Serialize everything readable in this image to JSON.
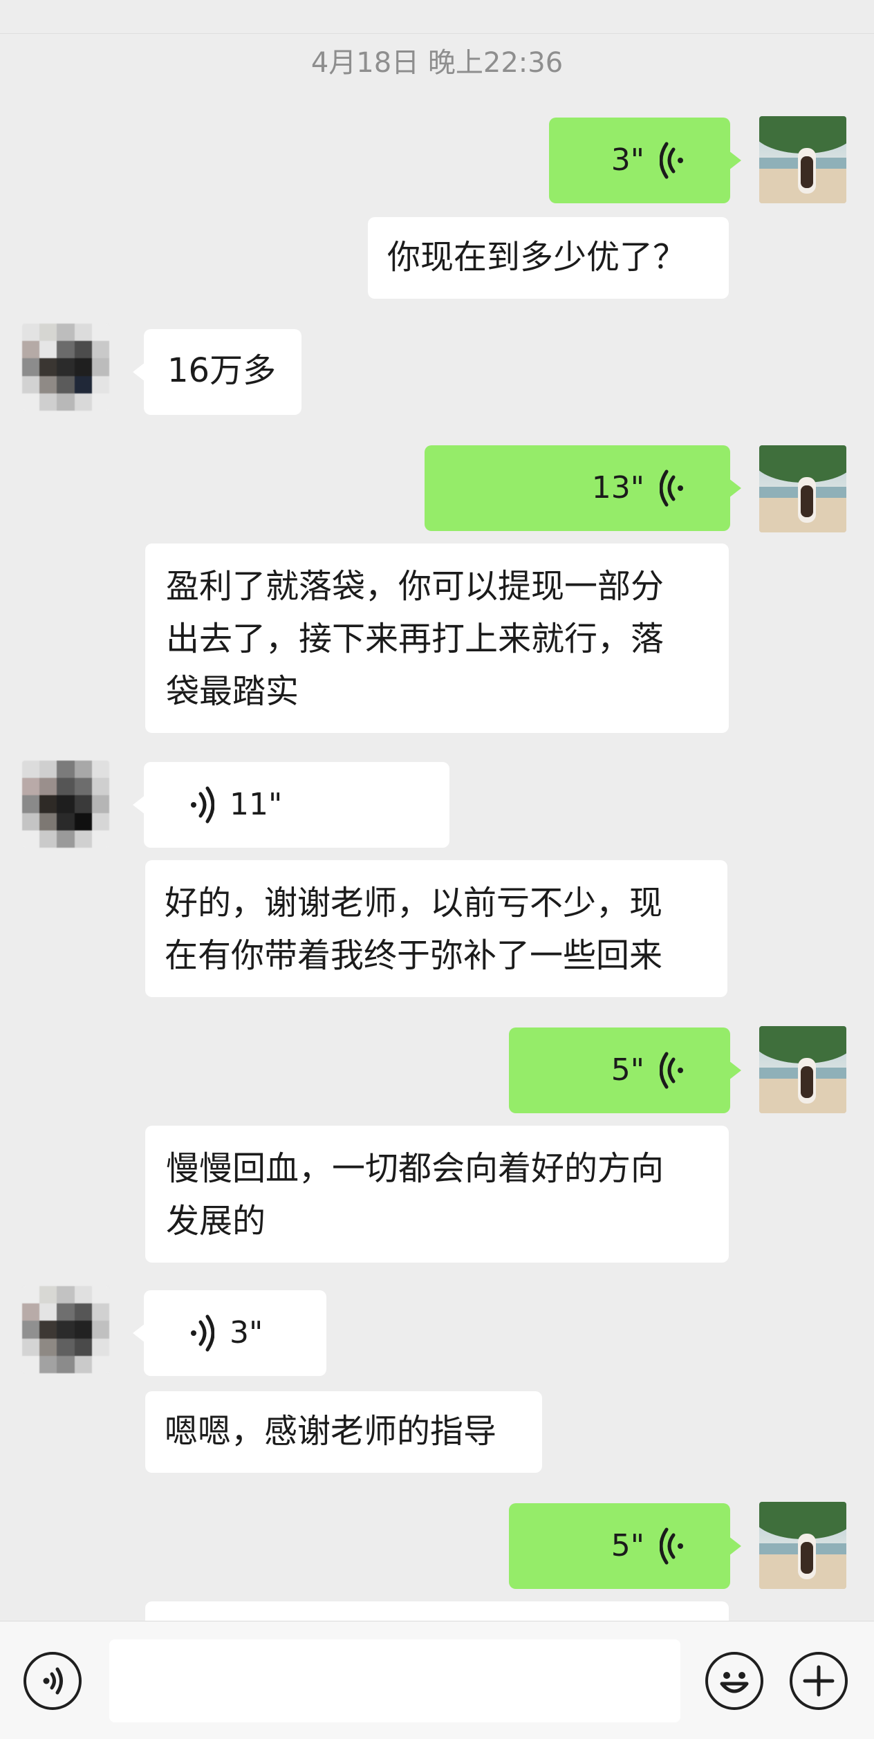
{
  "timestamp": "4月18日 晚上22:36",
  "messages": [
    {
      "type": "voice",
      "side": "right",
      "duration": "3\""
    },
    {
      "type": "text",
      "side": "right",
      "text": "你现在到多少优了？"
    },
    {
      "type": "text",
      "side": "left",
      "text": "16万多"
    },
    {
      "type": "voice",
      "side": "right",
      "duration": "13\""
    },
    {
      "type": "text",
      "side": "right",
      "lines": [
        "盈利了就落袋，你可以提现一部分",
        "出去了，接下来再打上来就行，落",
        "袋最踏实"
      ]
    },
    {
      "type": "voice",
      "side": "left",
      "duration": "11\""
    },
    {
      "type": "text",
      "side": "left",
      "lines": [
        "好的，谢谢老师，以前亏不少，现",
        "在有你带着我终于弥补了一些回来"
      ]
    },
    {
      "type": "voice",
      "side": "right",
      "duration": "5\""
    },
    {
      "type": "text",
      "side": "right",
      "lines": [
        "慢慢回血，一切都会向着好的方向",
        "发展的"
      ]
    },
    {
      "type": "voice",
      "side": "left",
      "duration": "3\""
    },
    {
      "type": "text",
      "side": "left",
      "text": "嗯嗯，感谢老师的指导"
    },
    {
      "type": "voice",
      "side": "right",
      "duration": "5\""
    }
  ],
  "input": {
    "placeholder": ""
  },
  "icons": {
    "voice_toggle": "voice-mode-icon",
    "emoji": "emoji-icon",
    "more": "plus-icon"
  },
  "colors": {
    "sent_bubble": "#95ec69",
    "received_bubble": "#ffffff",
    "background": "#ededed"
  }
}
